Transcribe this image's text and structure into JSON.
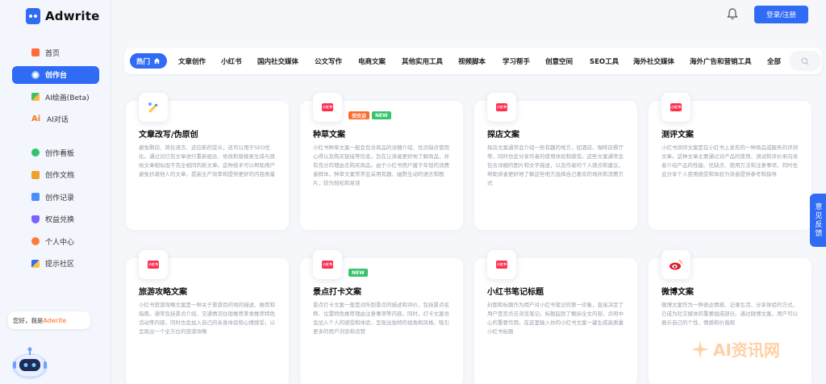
{
  "app": {
    "name": "Adwrite"
  },
  "sidebar": {
    "items": [
      {
        "label": "首页",
        "icon": "home-icon",
        "active": false
      },
      {
        "label": "创作台",
        "icon": "create-icon",
        "active": true
      },
      {
        "label": "AI绘画(Beta)",
        "icon": "paint-icon",
        "active": false
      },
      {
        "label": "AI对话",
        "icon": "ai-chat-icon",
        "active": false
      },
      {
        "label": "创作看板",
        "icon": "board-icon",
        "active": false
      },
      {
        "label": "创作文档",
        "icon": "docs-icon",
        "active": false
      },
      {
        "label": "创作记录",
        "icon": "records-icon",
        "active": false
      },
      {
        "label": "权益兑换",
        "icon": "crown-icon",
        "active": false
      },
      {
        "label": "个人中心",
        "icon": "user-icon",
        "active": false
      },
      {
        "label": "提示社区",
        "icon": "community-icon",
        "active": false
      }
    ],
    "assistant": {
      "prefix": "您好，我是",
      "brand": "Adwrite"
    }
  },
  "header": {
    "login_label": "登录/注册",
    "bell_icon": "bell-icon"
  },
  "tabs": [
    {
      "label": "热门",
      "active": true
    },
    {
      "label": "文章创作"
    },
    {
      "label": "小红书"
    },
    {
      "label": "国内社交媒体"
    },
    {
      "label": "公文写作"
    },
    {
      "label": "电商文案"
    },
    {
      "label": "其他实用工具"
    },
    {
      "label": "视频脚本"
    },
    {
      "label": "学习帮手"
    },
    {
      "label": "创意空间"
    },
    {
      "label": "SEO工具"
    },
    {
      "label": "海外社交媒体"
    },
    {
      "label": "海外广告和营销工具"
    },
    {
      "label": "全部"
    }
  ],
  "cards": [
    {
      "title": "文章改写/伪原创",
      "icon": "pen-icon",
      "badges": [],
      "desc": "避免剽窃、简化语言、适应新的受众，还可以用于SEO优化。通过对已有文章进行重新组合、修改和替换来生成与原始文章相似但不完全相同的新文章。这种技术可以帮助用户避免抄袭他人的文章，提高生产效率和提供更好的内容质量"
    },
    {
      "title": "种草文案",
      "icon": "xiaohongshu-icon",
      "badges": [
        "受欢迎",
        "NEW"
      ],
      "desc": "小红书种草文案一般会包含商品的详细介绍、优点缺点使用心得以及购买链接等信息，旨在让读者更好地了解商品，并有充分的理由去购买商品。由于小红书用户属于年轻的消费者群体，种草文案常常会采用有趣、幽默生动的语言和图片，较为轻松和易读"
    },
    {
      "title": "探店文案",
      "icon": "xiaohongshu-icon",
      "badges": [],
      "desc": "探店文案通常会介绍一些有趣的地方，如酒店、咖啡店餐厅等，同时也会分享作者的使用体验和感受。这些文案通常会包含详细的图片和文字描述，以及作者的个人观点和建议，帮助读者更好地了解这些地方选择自己喜欢的场所和消费方式"
    },
    {
      "title": "测评文案",
      "icon": "xiaohongshu-icon",
      "badges": [],
      "desc": "小红书测评文案是在小红书上发布的一种商品或服务的评测文章。这种文章主要通过对产品的使用、测试和评价来向读者介绍产品的性能、优缺点、使用方法和注意事项，同时也会分享个人使用感受和体验为读者提供参考和指导"
    },
    {
      "title": "旅游攻略文案",
      "icon": "xiaohongshu-icon",
      "badges": [],
      "desc": "小红书旅游攻略文案是一种关于旅游目的地的描述、推荐和指南，通常包括景点介绍、交通情况住宿推荐美食推荐特色活动等内容。同时也会加入自己的亲身体验和心情感受，以呈现出一个全方位的旅游攻略"
    },
    {
      "title": "景点打卡文案",
      "icon": "xiaohongshu-icon",
      "badges": [
        "NEW"
      ],
      "desc": "景点打卡文案一般是对所到景点的描述和评价，包括景点名称、位置特色推荐理由注意事项等内容。同时，打卡文案也会加入个人的感受和体验，呈现出独特的视角和风格，吸引更多的用户浏览和点赞"
    },
    {
      "title": "小红书笔记标题",
      "icon": "xiaohongshu-icon",
      "badges": [],
      "desc": "封面和标题作为用户对小红书笔记的第一印象，直接决定了用户是否点击浏览笔记。标题起到了概括全文内容，点明中心的重要作用。在这里输入你的小红书文案一键生成高质量小红书标题"
    },
    {
      "title": "微博文案",
      "icon": "weibo-icon",
      "badges": [],
      "desc": "微博文案作为一种表达情感、记录生活、分享体验的方式，已成为社交媒体的重要组成部分。通过微博文案，用户可以展示自己的个性、情感和价值观"
    }
  ],
  "feedback_label": "意见反馈",
  "watermark": "AI资讯网",
  "colors": {
    "accent": "#2f6bf5",
    "hot_badge": "#ff6a2b",
    "new_badge": "#35c46b",
    "xiaohongshu": "#ff2e4d"
  }
}
